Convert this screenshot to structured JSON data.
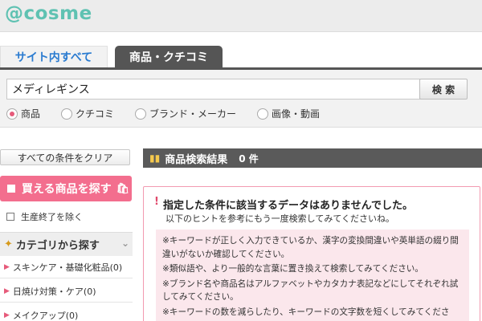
{
  "header": {
    "logo": "@cosme"
  },
  "tabs": {
    "all": "サイト内すべて",
    "products": "商品・クチコミ"
  },
  "search": {
    "value": "メディレギンス",
    "button": "検 索"
  },
  "radios": [
    {
      "label": "商品",
      "selected": true
    },
    {
      "label": "クチコミ",
      "selected": false
    },
    {
      "label": "ブランド・メーカー",
      "selected": false
    },
    {
      "label": "画像・動画",
      "selected": false
    }
  ],
  "sidebar": {
    "clear_button": "すべての条件をクリア",
    "buy_button": "買える商品を探す",
    "discontinued_label": "生産終了を除く",
    "category_header": "カテゴリから探す",
    "categories": [
      "スキンケア・基礎化粧品(0)",
      "日焼け対策・ケア(0)",
      "メイクアップ(0)"
    ]
  },
  "results": {
    "title": "商品検索結果",
    "count": "0 件",
    "no_match_title": "指定した条件に該当するデータはありませんでした。",
    "no_match_sub": "以下のヒントを参考にもう一度検索してみてくださいね。",
    "hints": [
      "※キーワードが正しく入力できているか、漢字の変換間違いや英単語の綴り間違いがないか確認してください。",
      "※類似語や、より一般的な言葉に置き換えて検索してみてください。",
      "※ブランド名や商品名はアルファベットやカタカナ表記などにしてそれぞれ試してみてください。",
      "※キーワードの数を減らしたり、キーワードの文字数を短くしてみてください。"
    ]
  },
  "colors": {
    "brand": "#5fc2b2",
    "accent_pink": "#f36e8e",
    "dark_bar": "#5a5a5a"
  }
}
